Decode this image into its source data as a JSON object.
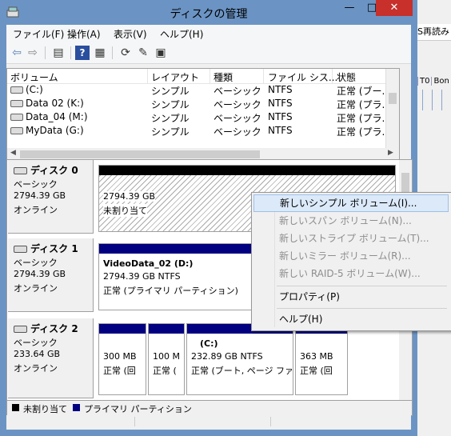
{
  "window": {
    "title": "ディスクの管理",
    "controls": {
      "minimize": "—",
      "maximize": "□",
      "close": "✕"
    }
  },
  "background_window": {
    "text1": "S再読み",
    "cols": [
      "T0",
      "Bon",
      "k"
    ]
  },
  "menu": [
    "ファイル(F)",
    "操作(A)",
    "表示(V)",
    "ヘルプ(H)"
  ],
  "toolbar": [
    "back-icon",
    "forward-icon",
    "console-tree-icon",
    "help-icon",
    "details-icon",
    "refresh-icon",
    "properties-icon",
    "help-topic-icon"
  ],
  "volume_list": {
    "headers": [
      "ボリューム",
      "レイアウト",
      "種類",
      "ファイル シス...",
      "状態"
    ],
    "rows": [
      [
        "(C:)",
        "シンプル",
        "ベーシック",
        "NTFS",
        "正常 (ブー..."
      ],
      [
        "Data 02 (K:)",
        "シンプル",
        "ベーシック",
        "NTFS",
        "正常 (プラ..."
      ],
      [
        "Data_04 (M:)",
        "シンプル",
        "ベーシック",
        "NTFS",
        "正常 (プラ..."
      ],
      [
        "MyData (G:)",
        "シンプル",
        "ベーシック",
        "NTFS",
        "正常 (プラ..."
      ]
    ]
  },
  "disks": [
    {
      "name": "ディスク 0",
      "type": "ベーシック",
      "size": "2794.39 GB",
      "status": "オンライン",
      "partitions": [
        {
          "title": "",
          "line1": "2794.39 GB",
          "line2": "未割り当て",
          "kind": "unallocated"
        }
      ]
    },
    {
      "name": "ディスク 1",
      "type": "ベーシック",
      "size": "2794.39 GB",
      "status": "オンライン",
      "partitions": [
        {
          "title": "VideoData_02 (D:)",
          "line1": "2794.39 GB NTFS",
          "line2": "正常 (プライマリ パーティション)",
          "kind": "primary"
        }
      ]
    },
    {
      "name": "ディスク 2",
      "type": "ベーシック",
      "size": "233.64 GB",
      "status": "オンライン",
      "partitions": [
        {
          "title": "",
          "line1": "300 MB",
          "line2": "正常 (回",
          "kind": "primary"
        },
        {
          "title": "",
          "line1": "100 M",
          "line2": "正常 (",
          "kind": "primary"
        },
        {
          "title": "(C:)",
          "line1": "232.89 GB NTFS",
          "line2": "正常 (ブート, ページ ファ",
          "kind": "primary"
        },
        {
          "title": "",
          "line1": "363 MB",
          "line2": "正常 (回",
          "kind": "primary"
        }
      ]
    }
  ],
  "legend": [
    {
      "label": "未割り当て",
      "color": "#000000"
    },
    {
      "label": "プライマリ パーティション",
      "color": "#000080"
    }
  ],
  "context_menu": {
    "items": [
      {
        "label": "新しいシンプル ボリューム(I)...",
        "enabled": true,
        "highlighted": true
      },
      {
        "label": "新しいスパン ボリューム(N)...",
        "enabled": false
      },
      {
        "label": "新しいストライプ ボリューム(T)...",
        "enabled": false
      },
      {
        "label": "新しいミラー ボリューム(R)...",
        "enabled": false
      },
      {
        "label": "新しい RAID-5 ボリューム(W)...",
        "enabled": false
      },
      {
        "label": "プロパティ(P)",
        "enabled": true
      },
      {
        "label": "ヘルプ(H)",
        "enabled": true
      }
    ]
  },
  "colors": {
    "title_bg": "#6b94c4",
    "close": "#c7302b",
    "primary_bar": "#000080",
    "unallocated_bar": "#000000",
    "menu_highlight": "#dbe9f9"
  }
}
